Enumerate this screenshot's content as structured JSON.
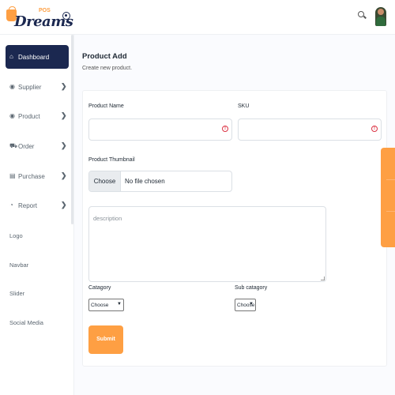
{
  "header": {
    "logo_word": "Dreams",
    "logo_badge": "POS",
    "icons": [
      "collapse-toggle-icon",
      "search-icon",
      "user-avatar"
    ]
  },
  "sidebar": {
    "items": [
      {
        "label": "Dashboard",
        "icon": "home-icon",
        "active": true,
        "has_children": false
      },
      {
        "label": "Supplier",
        "icon": "supplier-icon",
        "active": false,
        "has_children": true
      },
      {
        "label": "Product",
        "icon": "product-icon",
        "active": false,
        "has_children": true
      },
      {
        "label": "Order",
        "icon": "cart-icon",
        "active": false,
        "has_children": true
      },
      {
        "label": "Purchase",
        "icon": "purchase-icon",
        "active": false,
        "has_children": true
      },
      {
        "label": "Report",
        "icon": "report-icon",
        "active": false,
        "has_children": true
      }
    ],
    "plain_items": [
      "Logo",
      "Navbar",
      "Slider",
      "Social Media"
    ],
    "chevron": "❯"
  },
  "page": {
    "title": "Product Add",
    "subtitle": "Create new product."
  },
  "form": {
    "product_name_label": "Product Name",
    "product_name_value": "",
    "sku_label": "SKU",
    "sku_value": "",
    "thumbnail_label": "Product Thumbnail",
    "file_button": "Choose File",
    "file_status": "No file chosen",
    "description_placeholder": "description",
    "category_label": "Catagory",
    "category_selected": "Choose",
    "subcategory_label": "Sub catagory",
    "subcategory_selected": "Choose",
    "submit_label": "Submit"
  },
  "colors": {
    "sidebar_active": "#1b2850",
    "accent": "#fe9f43",
    "warning": "#dc3545"
  }
}
